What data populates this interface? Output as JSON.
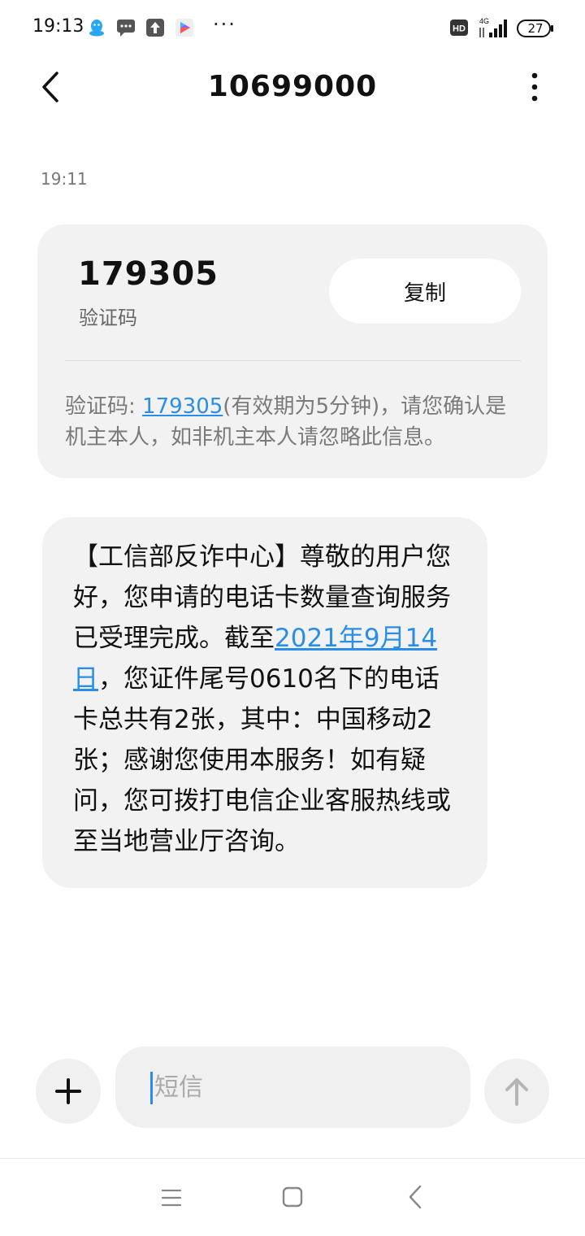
{
  "status_bar": {
    "time": "19:13",
    "dots": "···",
    "hd": "HD",
    "network": "4G",
    "battery": "27",
    "icons": [
      "qq-icon",
      "message-icon",
      "upload-icon",
      "video-play-icon",
      "hd-icon",
      "signal-icon",
      "battery-icon"
    ]
  },
  "header": {
    "title": "10699000",
    "back_icon": "back-arrow-icon",
    "more_icon": "more-vertical-icon"
  },
  "messages": {
    "timestamp": "19:11",
    "verification": {
      "code": "179305",
      "code_label": "验证码",
      "copy_label": "复制",
      "text_prefix": "验证码: ",
      "text_code": "179305",
      "text_suffix": "(有效期为5分钟)，请您确认是机主本人，如非机主本人请忽略此信息。"
    },
    "notice": {
      "text_before": "【工信部反诈中心】尊敬的用户您好，您申请的电话卡数量查询服务已受理完成。截至",
      "date_link": "2021年9月14日",
      "text_after": "，您证件尾号0610名下的电话卡总共有2张，其中：中国移动2张；感谢您使用本服务！如有疑问，您可拨打电信企业客服热线或至当地营业厅咨询。"
    }
  },
  "input": {
    "placeholder": "短信",
    "add_icon": "plus-icon",
    "send_icon": "send-arrow-icon"
  },
  "navbar": {
    "icons": [
      "menu-icon",
      "home-square-icon",
      "back-triangle-icon"
    ]
  },
  "colors": {
    "link": "#2a8ee8",
    "bubble": "#f2f2f2",
    "muted_text": "#7a7a7a"
  }
}
